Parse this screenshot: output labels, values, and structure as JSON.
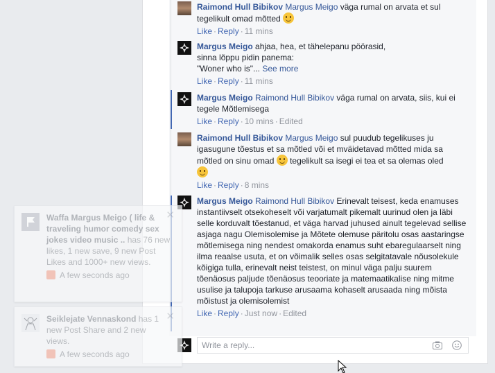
{
  "comments": [
    {
      "avatar_icon": "raimond-avatar",
      "author": "Raimond Hull Bibikov",
      "mention": "Margus Meigo",
      "text": "väga rumal on arvata et sul tegelikult omad mõtted",
      "has_smiley": true,
      "like": "Like",
      "reply": "Reply",
      "time": "11 mins",
      "edited": ""
    },
    {
      "avatar_icon": "margus-avatar",
      "author": "Margus Meigo",
      "mention": "",
      "line1": "ahjaa, hea, et tähelepanu pöörasid,",
      "line2": "sinna lõppu pidin panema:",
      "line3": "\"Woner who is\"...",
      "see_more": "See more",
      "like": "Like",
      "reply": "Reply",
      "time": "11 mins"
    },
    {
      "avatar_icon": "margus-avatar",
      "author": "Margus Meigo",
      "mention": "Raimond Hull Bibikov",
      "text": "väga rumal on arvata, siis, kui ei tegele Mõtlemisega",
      "like": "Like",
      "reply": "Reply",
      "time": "10 mins",
      "edited": "Edited"
    },
    {
      "avatar_icon": "raimond-avatar",
      "author": "Raimond Hull Bibikov",
      "mention": "Margus Meigo",
      "text_a": "sul puudub tegelikuses ju igasugune tõestus et sa mõtled või et mväidetavad mõtted mida sa mõtled on sinu omad",
      "text_b": "tegelikult sa isegi ei tea et sa olemas oled",
      "like": "Like",
      "reply": "Reply",
      "time": "8 mins"
    },
    {
      "avatar_icon": "margus-avatar",
      "author": "Margus Meigo",
      "mention": "Raimond Hull Bibikov",
      "text": "Erinevalt teisest, keda enamuses instantiivselt otsekoheselt või varjatumalt pikemalt uurinud olen ja läbi selle korduvalt tõestanud, et väga harvad juhused ainult tegelevad sellise asjaga nagu Olemisolemise ja Mõtete olemuse päritolu osas aastaringse mõtlemisega ning nendest omakorda enamus suht ebaregulaarselt ning ilma reaalse usuta, et on võimalik selles osas selgitatavale nõusolekule kõigiga tulla, erinevalt neist teistest, on minul väga palju suurem tõenäosus paljude tõenäosus teooriate ja matemaatikalise ning mitme usulise ja talupoja tarkuse arusaama kohaselt arusaada ning mõista mõistust ja olemisolemist",
      "like": "Like",
      "reply": "Reply",
      "time": "Just now",
      "edited": "Edited"
    }
  ],
  "reply_box": {
    "placeholder": "Write a reply...",
    "camera_icon": "camera-icon",
    "emoji_icon": "emoji-icon"
  },
  "notifications": [
    {
      "name": "Waffa Margus Meigo ( life & traveling humor comedy sex jokes video music ..",
      "rest": "has 76 new likes, 1 new save, 9 new Post Likes and 1000+ new views.",
      "time": "A few seconds ago",
      "close": "✕"
    },
    {
      "name": "Seiklejate Vennaskond",
      "rest": "has 1 new Post Share and 2 new views.",
      "time": "A few seconds ago",
      "close": "✕"
    }
  ],
  "colors": {
    "link": "#365899",
    "thread_line": "#4267b2",
    "meta": "#90949c"
  }
}
